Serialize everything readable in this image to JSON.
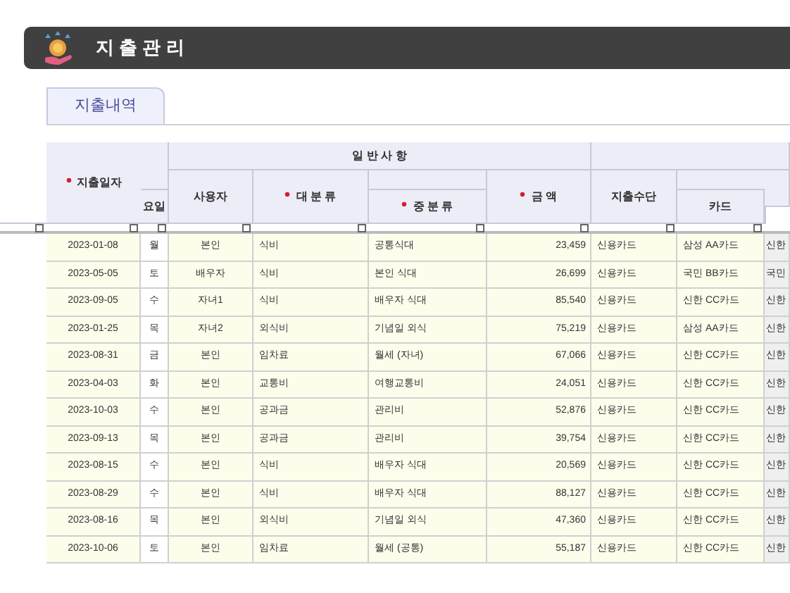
{
  "title": "지 출 관 리",
  "tabs": [
    {
      "label": "지출내역",
      "selected": true
    }
  ],
  "table": {
    "group_header": "일 반 사 항",
    "columns": [
      {
        "label": "지출일자",
        "required": true
      },
      {
        "label": "요일",
        "required": false
      },
      {
        "label": "사용자",
        "required": false
      },
      {
        "label": "대 분 류",
        "required": true
      },
      {
        "label": "중 분 류",
        "required": true
      },
      {
        "label": "금 액",
        "required": true
      },
      {
        "label": "지출수단",
        "required": false
      },
      {
        "label": "카드",
        "required": false
      }
    ],
    "rows": [
      [
        "2023-01-08",
        "월",
        "본인",
        "식비",
        "공통식대",
        "23,459",
        "신용카드",
        "삼성 AA카드",
        "신한"
      ],
      [
        "2023-05-05",
        "토",
        "배우자",
        "식비",
        "본인 식대",
        "26,699",
        "신용카드",
        "국민 BB카드",
        "국민"
      ],
      [
        "2023-09-05",
        "수",
        "자녀1",
        "식비",
        "배우자 식대",
        "85,540",
        "신용카드",
        "신한 CC카드",
        "신한"
      ],
      [
        "2023-01-25",
        "목",
        "자녀2",
        "외식비",
        "기념일 외식",
        "75,219",
        "신용카드",
        "삼성 AA카드",
        "신한"
      ],
      [
        "2023-08-31",
        "금",
        "본인",
        "임차료",
        "월세 (자녀)",
        "67,066",
        "신용카드",
        "신한 CC카드",
        "신한"
      ],
      [
        "2023-04-03",
        "화",
        "본인",
        "교통비",
        "여행교통비",
        "24,051",
        "신용카드",
        "신한 CC카드",
        "신한"
      ],
      [
        "2023-10-03",
        "수",
        "본인",
        "공과금",
        "관리비",
        "52,876",
        "신용카드",
        "신한 CC카드",
        "신한"
      ],
      [
        "2023-09-13",
        "목",
        "본인",
        "공과금",
        "관리비",
        "39,754",
        "신용카드",
        "신한 CC카드",
        "신한"
      ],
      [
        "2023-08-15",
        "수",
        "본인",
        "식비",
        "배우자 식대",
        "20,569",
        "신용카드",
        "신한 CC카드",
        "신한"
      ],
      [
        "2023-08-29",
        "수",
        "본인",
        "식비",
        "배우자 식대",
        "88,127",
        "신용카드",
        "신한 CC카드",
        "신한"
      ],
      [
        "2023-08-16",
        "목",
        "본인",
        "외식비",
        "기념일 외식",
        "47,360",
        "신용카드",
        "신한 CC카드",
        "신한"
      ],
      [
        "2023-10-06",
        "토",
        "본인",
        "임차료",
        "월세 (공통)",
        "55,187",
        "신용카드",
        "신한 CC카드",
        "신한"
      ]
    ]
  }
}
